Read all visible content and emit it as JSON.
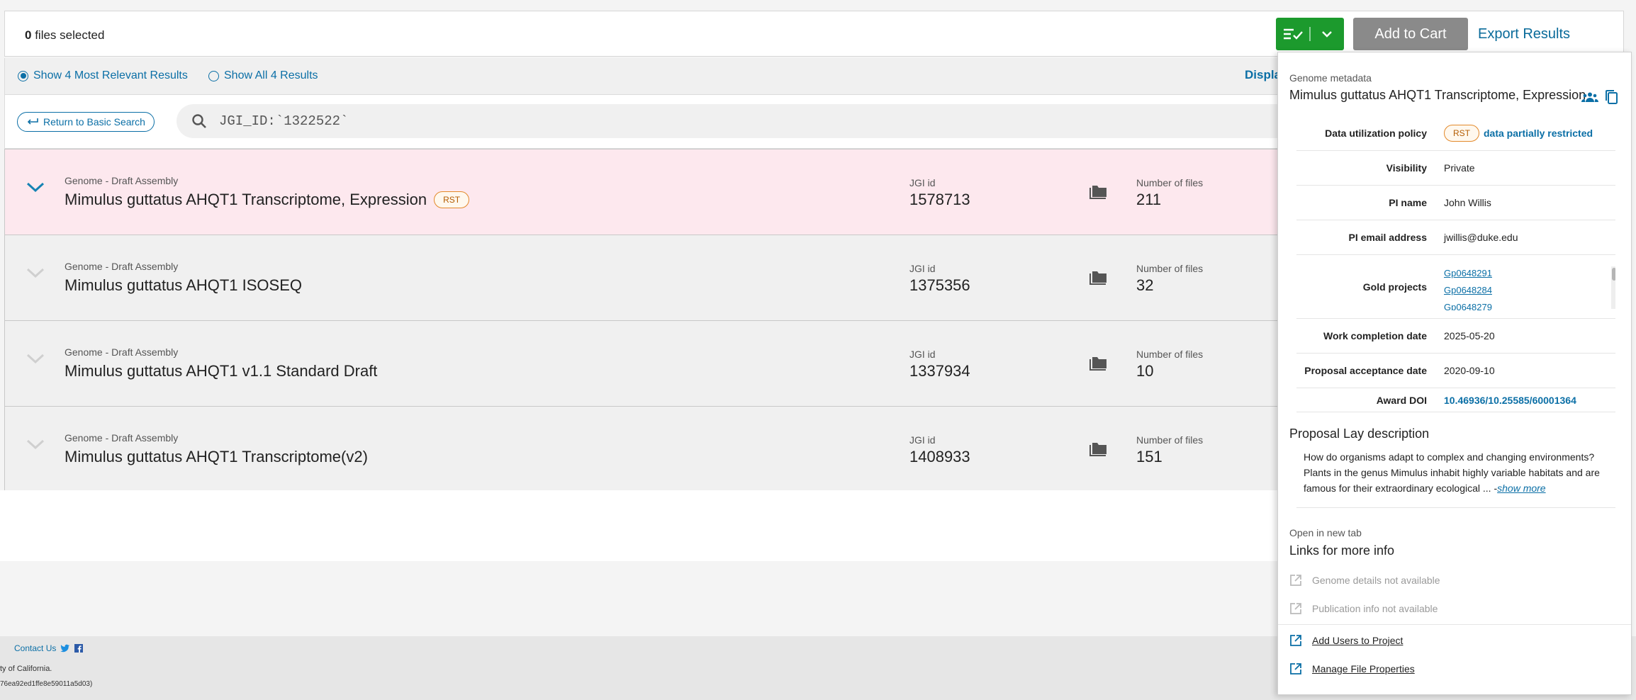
{
  "topbar": {
    "selected_count": "0",
    "selected_suffix": " files selected",
    "add_to_cart": "Add to Cart",
    "export_results": "Export Results"
  },
  "radios": {
    "relevant": "Show 4 Most Relevant Results",
    "all": "Show All 4 Results",
    "display_link": "Displa"
  },
  "search": {
    "return_label": "Return to Basic Search",
    "query": "JGI_ID:`1322522`"
  },
  "results": [
    {
      "kind": "Genome - Draft Assembly",
      "title": "Mimulus guttatus AHQT1 Transcriptome, Expression",
      "badge": "RST",
      "jgi_label": "JGI id",
      "jgi_id": "1578713",
      "files_label": "Number of files",
      "files": "211"
    },
    {
      "kind": "Genome - Draft Assembly",
      "title": "Mimulus guttatus AHQT1 ISOSEQ",
      "jgi_label": "JGI id",
      "jgi_id": "1375356",
      "files_label": "Number of files",
      "files": "32"
    },
    {
      "kind": "Genome - Draft Assembly",
      "title": "Mimulus guttatus AHQT1 v1.1 Standard Draft",
      "jgi_label": "JGI id",
      "jgi_id": "1337934",
      "files_label": "Number of files",
      "files": "10"
    },
    {
      "kind": "Genome - Draft Assembly",
      "title": "Mimulus guttatus AHQT1 Transcriptome(v2)",
      "jgi_label": "JGI id",
      "jgi_id": "1408933",
      "files_label": "Number of files",
      "files": "151"
    }
  ],
  "footer": {
    "contact": "Contact Us",
    "line1": "ty of California.",
    "line2": "76ea92ed1ffe8e59011a5d03)"
  },
  "panel": {
    "subtitle": "Genome metadata",
    "title": "Mimulus guttatus AHQT1 Transcriptome, Expression",
    "meta": {
      "dup_label": "Data utilization policy",
      "dup_badge": "RST",
      "dup_value": "data partially restricted",
      "visibility_label": "Visibility",
      "visibility_value": "Private",
      "pi_label": "PI name",
      "pi_value": "John Willis",
      "email_label": "PI email address",
      "email_value": "jwillis@duke.edu",
      "gold_label": "Gold projects",
      "gold": [
        "Gp0648291",
        "Gp0648284",
        "Gp0648279"
      ],
      "completion_label": "Work completion date",
      "completion_value": "2025-05-20",
      "acceptance_label": "Proposal acceptance date",
      "acceptance_value": "2020-09-10",
      "doi_label": "Award DOI",
      "doi_value": "10.46936/10.25585/60001364"
    },
    "lay_title": "Proposal Lay description",
    "lay_desc": "How do organisms adapt to complex and changing environments? Plants in the genus Mimulus inhabit highly variable habitats and are famous for their extraordinary ecological ... -",
    "show_more": "show more",
    "new_tab": "Open in new tab",
    "links_title": "Links for more info",
    "links": [
      {
        "label": "Genome details not available"
      },
      {
        "label": "Publication info not available"
      },
      {
        "label": "Add Users to Project"
      },
      {
        "label": "Manage File Properties"
      }
    ]
  },
  "colors": {
    "green": "#1c9a2d",
    "link_blue": "#0b6fa6",
    "active_row": "#fde8ee",
    "rst_orange": "#e3892a"
  }
}
